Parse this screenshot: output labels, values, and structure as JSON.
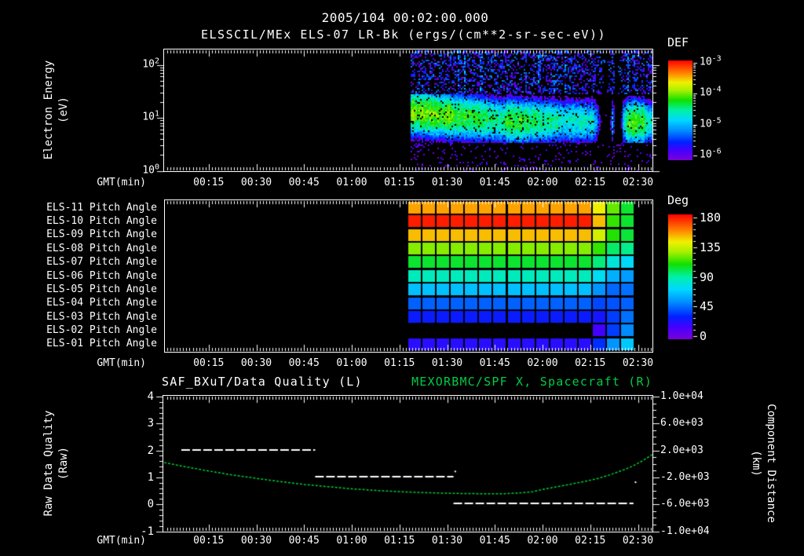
{
  "header": {
    "datetime": "2005/104 00:02:00.000",
    "instrument_title": "ELSSCIL/MEx ELS-07 LR-Bk (ergs/(cm**2-sr-sec-eV))"
  },
  "colors": {
    "background": "#000000",
    "foreground": "#ffffff",
    "panel_border": "#ffffff",
    "right_title_green": "#00cc44",
    "spacecraft_curve_green": "#00cc33",
    "quality_line_white": "#ffffff",
    "rainbow_stops": [
      [
        0.0,
        "#7a00d8"
      ],
      [
        0.1,
        "#4400ff"
      ],
      [
        0.18,
        "#0020ff"
      ],
      [
        0.3,
        "#0090ff"
      ],
      [
        0.4,
        "#00d8ff"
      ],
      [
        0.5,
        "#00f0a8"
      ],
      [
        0.6,
        "#10e000"
      ],
      [
        0.7,
        "#a8f000"
      ],
      [
        0.78,
        "#f0f000"
      ],
      [
        0.86,
        "#ff9000"
      ],
      [
        1.0,
        "#ff0000"
      ]
    ]
  },
  "time_axis": {
    "label": "GMT(min)",
    "start_min": 0,
    "end_min": 155,
    "major_tick_interval_min": 15,
    "minor_tick_interval_min": 1,
    "major_tick_labels": [
      "00:15",
      "00:30",
      "00:45",
      "01:00",
      "01:15",
      "01:30",
      "01:45",
      "02:00",
      "02:15",
      "02:30"
    ]
  },
  "chart_data": [
    {
      "id": "electron-energy-spectrogram",
      "type": "heatmap",
      "title": "ELSSCIL/MEx ELS-07 LR-Bk (ergs/(cm**2-sr-sec-eV))",
      "xlabel": "GMT(min)",
      "ylabel_lines": [
        "Electron Energy",
        "(eV)"
      ],
      "yscale": "log",
      "ylim_ev": [
        1,
        190
      ],
      "ytick_labels": [
        "10^0",
        "10^1",
        "10^2"
      ],
      "colorbar": {
        "title": "DEF",
        "scale": "log",
        "tick_labels": [
          "10^-3",
          "10^-4",
          "10^-5",
          "10^-6"
        ],
        "value_range_log10": [
          -6,
          -3
        ]
      },
      "data_start_min": 78.5,
      "data_end_min": 155,
      "core_band": {
        "center_logE_profile": [
          [
            78.5,
            1.12
          ],
          [
            95,
            1.03
          ],
          [
            110,
            0.95
          ],
          [
            135,
            0.95
          ],
          [
            155,
            0.92
          ]
        ],
        "sigma_logE": 0.3,
        "peak_log10_profile": [
          [
            78.5,
            -4.0
          ],
          [
            90,
            -4.1
          ],
          [
            100,
            -4.3
          ],
          [
            106,
            -4.5
          ],
          [
            110,
            -4.2
          ],
          [
            116,
            -4.35
          ],
          [
            122,
            -4.55
          ],
          [
            130,
            -4.6
          ],
          [
            136,
            -4.65
          ],
          [
            138.5,
            -6.2
          ],
          [
            141,
            -6.2
          ],
          [
            141.8,
            -4.9
          ],
          [
            142.6,
            -6.2
          ],
          [
            144.4,
            -6.2
          ],
          [
            145.2,
            -4.8
          ],
          [
            146.5,
            -4.15
          ],
          [
            151.5,
            -4.2
          ],
          [
            153,
            -4.55
          ],
          [
            155,
            -4.6
          ]
        ]
      },
      "high_band": {
        "logE_range": [
          1.45,
          2.29
        ],
        "intensity_log10": [
          -6.1,
          -5.1
        ],
        "fill_fraction": 0.4
      },
      "low_band": {
        "logE_range": [
          0,
          0.55
        ],
        "intensity_log10": [
          -6.1,
          -5.6
        ],
        "fill_fraction": 0.12
      },
      "dropout_intervals_min": [
        [
          138.5,
          141.0
        ],
        [
          142.6,
          144.4
        ]
      ]
    },
    {
      "id": "pitch-angle-heatmap",
      "type": "heatmap",
      "xlabel": "GMT(min)",
      "row_labels": [
        "ELS-11 Pitch Angle",
        "ELS-10 Pitch Angle",
        "ELS-09 Pitch Angle",
        "ELS-08 Pitch Angle",
        "ELS-07 Pitch Angle",
        "ELS-06 Pitch Angle",
        "ELS-05 Pitch Angle",
        "ELS-04 Pitch Angle",
        "ELS-03 Pitch Angle",
        "ELS-02 Pitch Angle",
        "ELS-01 Pitch Angle"
      ],
      "colorbar": {
        "title": "Deg",
        "tick_values": [
          180,
          135,
          90,
          45,
          0
        ],
        "value_range": [
          0,
          180
        ]
      },
      "column_start_min": 77.5,
      "column_width_min": 4.47,
      "values_deg": [
        [
          152,
          152,
          152,
          152,
          152,
          152,
          152,
          152,
          152,
          152,
          152,
          152,
          152,
          140,
          118,
          103
        ],
        [
          175,
          175,
          175,
          175,
          175,
          175,
          175,
          175,
          175,
          175,
          175,
          175,
          175,
          148,
          112,
          103
        ],
        [
          148,
          148,
          148,
          148,
          148,
          148,
          148,
          148,
          148,
          148,
          148,
          148,
          148,
          134,
          110,
          102
        ],
        [
          122,
          122,
          122,
          122,
          122,
          122,
          122,
          122,
          122,
          122,
          122,
          122,
          122,
          112,
          97,
          93
        ],
        [
          103,
          103,
          103,
          103,
          103,
          103,
          103,
          103,
          103,
          103,
          103,
          103,
          103,
          95,
          80,
          73
        ],
        [
          86,
          86,
          86,
          86,
          86,
          86,
          86,
          86,
          86,
          86,
          86,
          86,
          86,
          75,
          62,
          57
        ],
        [
          66,
          66,
          66,
          66,
          66,
          66,
          66,
          66,
          66,
          66,
          66,
          66,
          66,
          55,
          46,
          48
        ],
        [
          45,
          45,
          45,
          45,
          45,
          45,
          45,
          45,
          45,
          45,
          45,
          45,
          45,
          40,
          42,
          45
        ],
        [
          30,
          30,
          30,
          30,
          30,
          30,
          30,
          30,
          30,
          30,
          30,
          30,
          30,
          28,
          38,
          48
        ],
        [
          null,
          null,
          null,
          null,
          null,
          null,
          null,
          null,
          null,
          null,
          null,
          null,
          null,
          18,
          38,
          53
        ],
        [
          24,
          24,
          24,
          24,
          24,
          24,
          24,
          24,
          24,
          24,
          24,
          24,
          24,
          35,
          55,
          68
        ]
      ]
    },
    {
      "id": "quality-and-spacecraft",
      "type": "line",
      "title_left": "SAF_BXuT/Data Quality (L)",
      "title_right": "MEXORBMC/SPF X, Spacecraft (R)",
      "xlabel": "GMT(min)",
      "left_axis": {
        "label_lines": [
          "Raw Data Quality",
          "(Raw)"
        ],
        "range": [
          -1,
          4
        ],
        "tick_values": [
          4,
          3,
          2,
          1,
          0,
          -1
        ],
        "tick_labels": [
          "4",
          "3",
          "2",
          "1",
          "0",
          "-1"
        ],
        "minor_step": 0.2
      },
      "right_axis": {
        "label_lines": [
          "Component Distance",
          "(km)"
        ],
        "range": [
          -10000,
          10000
        ],
        "tick_values": [
          10000,
          6000,
          2000,
          -2000,
          -6000,
          -10000
        ],
        "tick_labels": [
          "1.0e+04",
          "6.0e+03",
          "2.0e+03",
          "-2.0e+03",
          "-6.0e+03",
          "-1.0e+04"
        ],
        "minor_step": 1000
      },
      "series": [
        {
          "name": "SAF_BXuT/Data Quality",
          "axis": "left",
          "style": "dashed",
          "color": "#ffffff",
          "segments": [
            {
              "t_min": 6.4,
              "t_end_min": 48.5,
              "value": 2
            },
            {
              "t_min": 48.5,
              "t_end_min": 92,
              "value": 1
            },
            {
              "t_min": 92,
              "t_end_min": 148.6,
              "value": 0
            }
          ],
          "dots": [
            [
              92.3,
              1.25
            ],
            [
              149,
              0.85
            ]
          ]
        },
        {
          "name": "MEXORBMC/SPF X Spacecraft",
          "axis": "right",
          "style": "dotted",
          "color": "#00cc33",
          "points_min_km": [
            [
              1,
              200
            ],
            [
              8,
              -450
            ],
            [
              15,
              -1050
            ],
            [
              22,
              -1600
            ],
            [
              30,
              -2150
            ],
            [
              38,
              -2650
            ],
            [
              45,
              -3050
            ],
            [
              53,
              -3400
            ],
            [
              60,
              -3700
            ],
            [
              68,
              -3950
            ],
            [
              75,
              -4120
            ],
            [
              82,
              -4250
            ],
            [
              88,
              -4330
            ],
            [
              95,
              -4400
            ],
            [
              102,
              -4430
            ],
            [
              108,
              -4420
            ],
            [
              113,
              -4300
            ],
            [
              117,
              -4100
            ],
            [
              121,
              -3700
            ],
            [
              125,
              -3350
            ],
            [
              129,
              -2990
            ],
            [
              133,
              -2620
            ],
            [
              137,
              -2220
            ],
            [
              141,
              -1650
            ],
            [
              145,
              -980
            ],
            [
              148,
              -400
            ],
            [
              151,
              350
            ],
            [
              154.6,
              1400
            ]
          ]
        }
      ]
    }
  ]
}
